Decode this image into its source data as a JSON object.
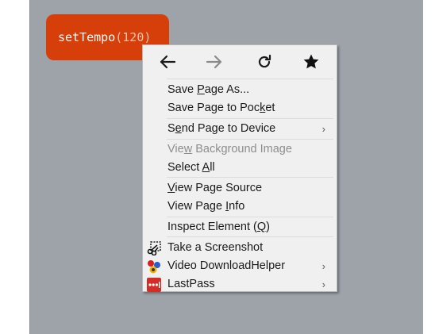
{
  "code": {
    "fn": "setTempo",
    "open": "(",
    "arg": "120",
    "close": ")"
  },
  "nav": {
    "back": "back-icon",
    "forward": "forward-icon",
    "reload": "reload-icon",
    "bookmark": "star-icon"
  },
  "menu": {
    "save_page_as": [
      "Save ",
      "P",
      "age As..."
    ],
    "save_to_pocket": [
      "Save Page to Poc",
      "k",
      "et"
    ],
    "send_to_device": [
      "S",
      "e",
      "nd Page to Device"
    ],
    "view_bg_image": [
      "Vie",
      "w",
      " Background Image"
    ],
    "select_all": [
      "Select ",
      "A",
      "ll"
    ],
    "view_source": [
      "",
      "V",
      "iew Page Source"
    ],
    "view_info": [
      "View Page ",
      "I",
      "nfo"
    ],
    "inspect": [
      "Inspect Element (",
      "Q",
      ")"
    ],
    "screenshot": "Take a Screenshot",
    "video_dl": "Video DownloadHelper",
    "lastpass": "LastPass",
    "submenu_chevron": "›"
  },
  "colors": {
    "pill": "#d63f0a",
    "page_bg": "#9ea3aa",
    "menu_bg": "#f0f0f0"
  }
}
